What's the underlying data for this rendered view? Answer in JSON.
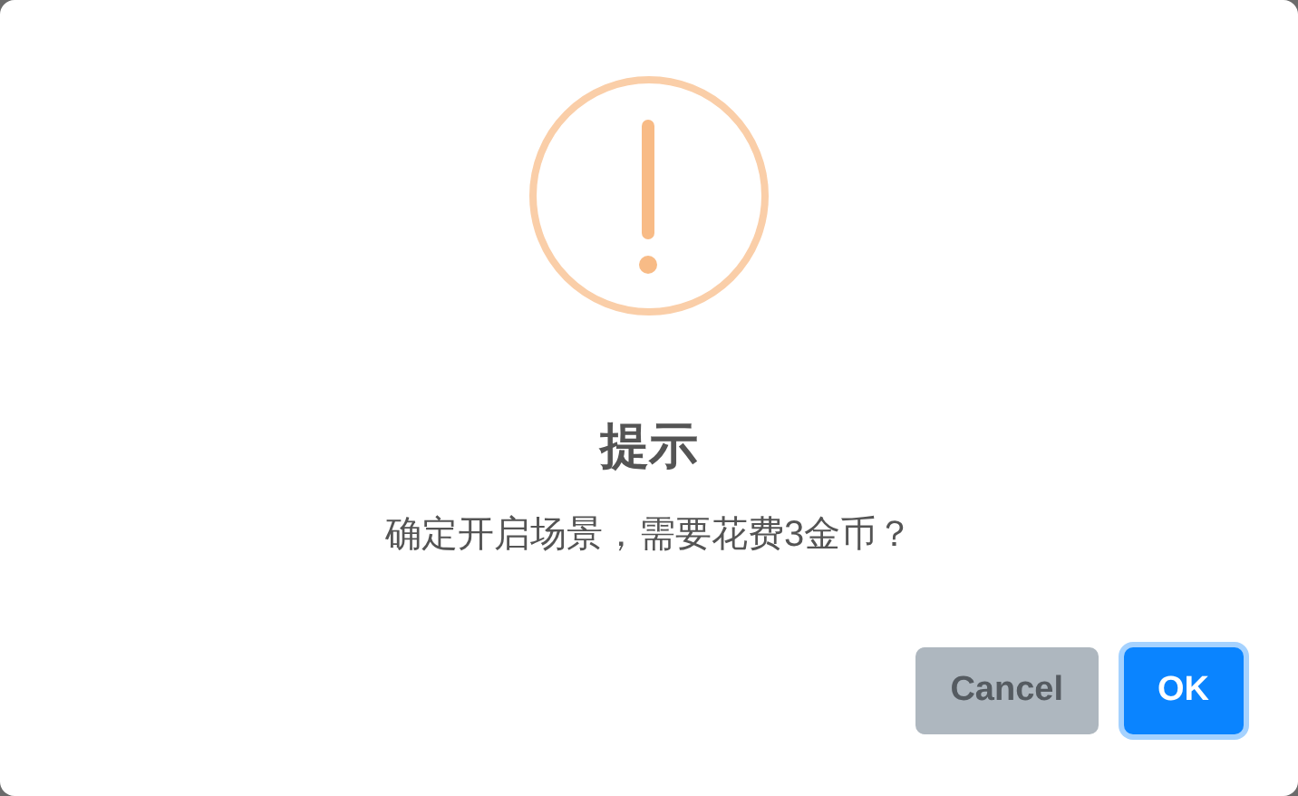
{
  "dialog": {
    "title": "提示",
    "message": "确定开启场景，需要花费3金币？",
    "buttons": [
      {
        "label": "Cancel",
        "kind": "cancel",
        "focused": false
      },
      {
        "label": "OK",
        "kind": "confirm",
        "focused": true
      }
    ]
  }
}
